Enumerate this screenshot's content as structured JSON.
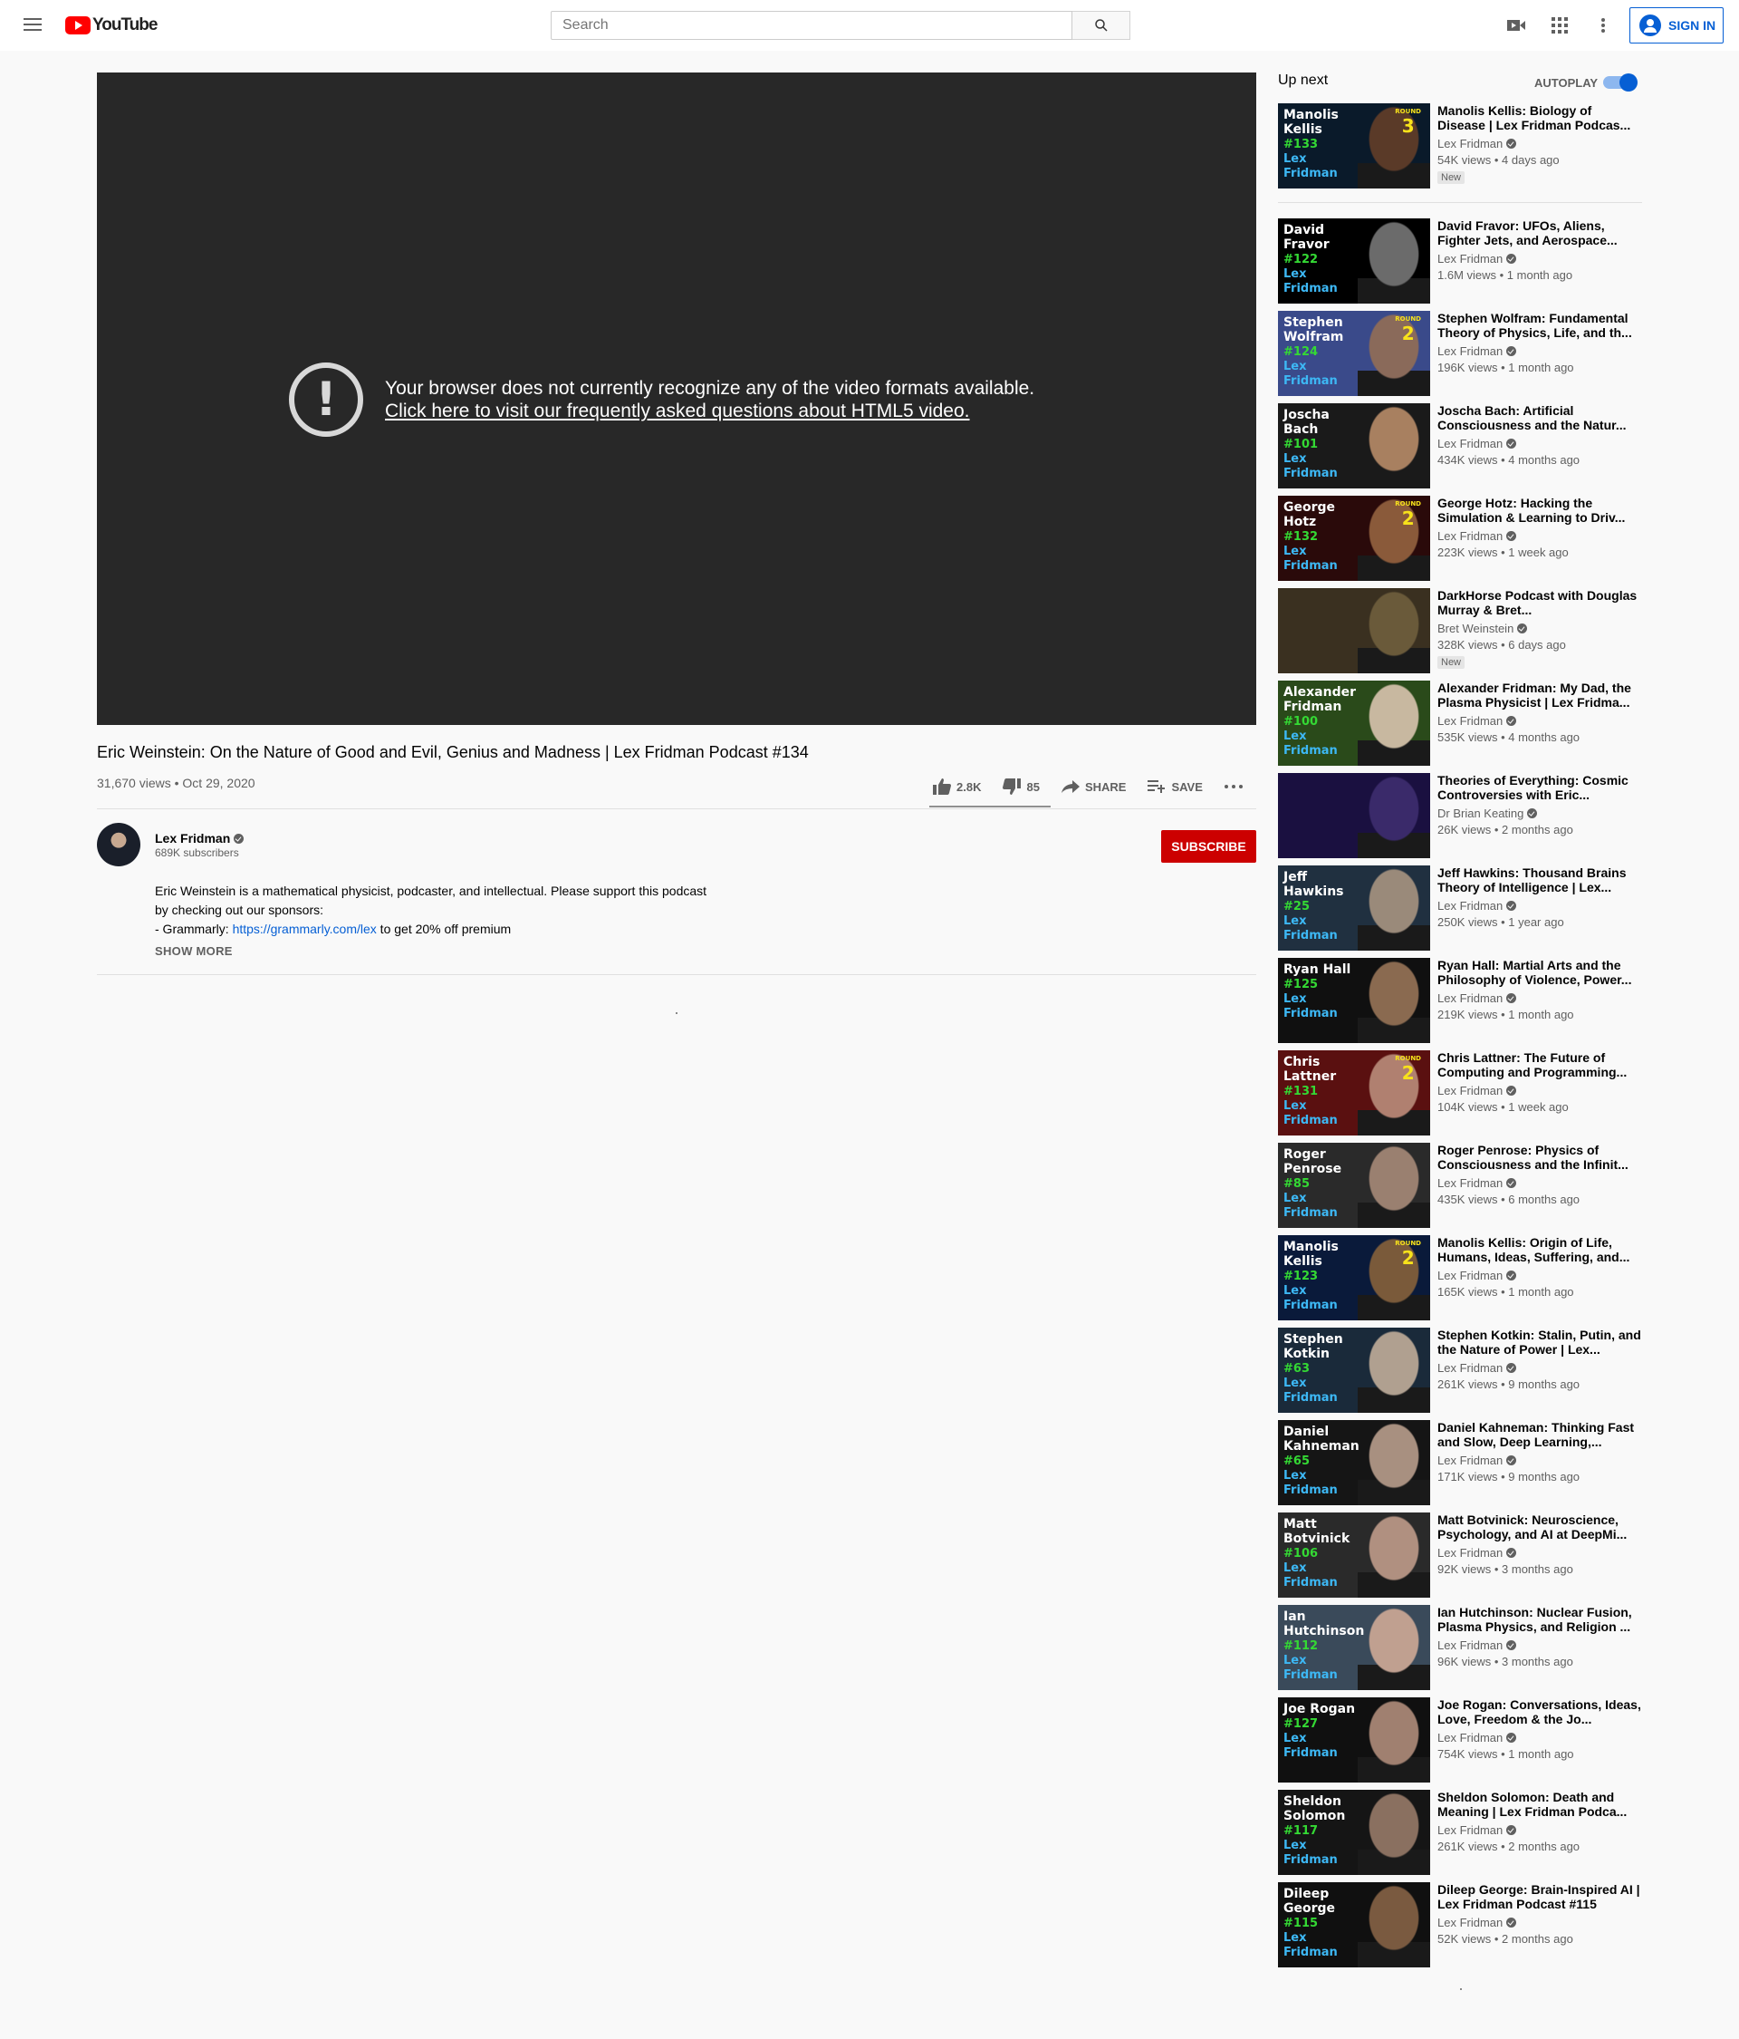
{
  "header": {
    "logo_text": "YouTube",
    "search_placeholder": "Search",
    "sign_in_label": "SIGN IN",
    "icons": [
      "menu-icon",
      "youtube-logo-icon",
      "search-icon",
      "create-video-icon",
      "apps-grid-icon",
      "more-vert-icon",
      "account-icon"
    ]
  },
  "player": {
    "error_line1": "Your browser does not currently recognize any of the video formats available.",
    "error_link": "Click here to visit our frequently asked questions about HTML5 video."
  },
  "video": {
    "title": "Eric Weinstein: On the Nature of Good and Evil, Genius and Madness | Lex Fridman Podcast #134",
    "meta": "31,670 views • Oct 29, 2020",
    "likes": "2.8K",
    "dislikes": "85",
    "share_label": "SHARE",
    "save_label": "SAVE"
  },
  "channel": {
    "name": "Lex Fridman",
    "subscribers": "689K subscribers",
    "subscribe_label": "SUBSCRIBE"
  },
  "description": {
    "line1": "Eric Weinstein is a mathematical physicist, podcaster, and intellectual. Please support this podcast",
    "line2": "by checking out our sponsors:",
    "line3_prefix": "- Grammarly: ",
    "line3_link": "https://grammarly.com/lex",
    "line3_suffix": " to get 20% off premium",
    "show_more": "SHOW MORE"
  },
  "sidebar": {
    "up_next": "Up next",
    "autoplay": "AUTOPLAY",
    "autoplay_on": true,
    "items": [
      {
        "thumb_name": "Manolis Kellis",
        "thumb_num": "#133",
        "round": "3",
        "title": "Manolis Kellis: Biology of Disease | Lex Fridman Podcas...",
        "channel": "Lex Fridman",
        "views": "54K views • 4 days ago",
        "badge": "New",
        "face": "#5a3a28",
        "bg": "#0a1a2a"
      },
      {
        "thumb_name": "David Fravor",
        "thumb_num": "#122",
        "round": "",
        "title": "David Fravor: UFOs, Aliens, Fighter Jets, and Aerospace...",
        "channel": "Lex Fridman",
        "views": "1.6M views • 1 month ago",
        "badge": "",
        "face": "#6b6b6b",
        "bg": "#000000"
      },
      {
        "thumb_name": "Stephen Wolfram",
        "thumb_num": "#124",
        "round": "2",
        "title": "Stephen Wolfram: Fundamental Theory of Physics, Life, and th...",
        "channel": "Lex Fridman",
        "views": "196K views • 1 month ago",
        "badge": "",
        "face": "#8a6a5a",
        "bg": "#3a4a8a"
      },
      {
        "thumb_name": "Joscha Bach",
        "thumb_num": "#101",
        "round": "",
        "title": "Joscha Bach: Artificial Consciousness and the Natur...",
        "channel": "Lex Fridman",
        "views": "434K views • 4 months ago",
        "badge": "",
        "face": "#a88060",
        "bg": "#1a1a1a"
      },
      {
        "thumb_name": "George Hotz",
        "thumb_num": "#132",
        "round": "2",
        "title": "George Hotz: Hacking the Simulation & Learning to Driv...",
        "channel": "Lex Fridman",
        "views": "223K views • 1 week ago",
        "badge": "",
        "face": "#8a5a3a",
        "bg": "#2a0a0a"
      },
      {
        "thumb_name": "",
        "thumb_num": "",
        "round": "",
        "title": "DarkHorse Podcast with Douglas Murray & Bret...",
        "channel": "Bret Weinstein",
        "views": "328K views • 6 days ago",
        "badge": "New",
        "face": "#6a5a3a",
        "bg": "#3a3020"
      },
      {
        "thumb_name": "Alexander Fridman",
        "thumb_num": "#100",
        "round": "",
        "title": "Alexander Fridman: My Dad, the Plasma Physicist | Lex Fridma...",
        "channel": "Lex Fridman",
        "views": "535K views • 4 months ago",
        "badge": "",
        "face": "#c8b8a0",
        "bg": "#2a4a1a"
      },
      {
        "thumb_name": "",
        "thumb_num": "",
        "round": "",
        "title": "Theories of Everything: Cosmic Controversies with Eric...",
        "channel": "Dr Brian Keating",
        "views": "26K views • 2 months ago",
        "badge": "",
        "face": "#3a2a6a",
        "bg": "#1a1040"
      },
      {
        "thumb_name": "Jeff Hawkins",
        "thumb_num": "#25",
        "round": "",
        "title": "Jeff Hawkins: Thousand Brains Theory of Intelligence | Lex...",
        "channel": "Lex Fridman",
        "views": "250K views • 1 year ago",
        "badge": "",
        "face": "#9a8a7a",
        "bg": "#203040"
      },
      {
        "thumb_name": "Ryan Hall",
        "thumb_num": "#125",
        "round": "",
        "title": "Ryan Hall: Martial Arts and the Philosophy of Violence, Power...",
        "channel": "Lex Fridman",
        "views": "219K views • 1 month ago",
        "badge": "",
        "face": "#8a6a50",
        "bg": "#101010"
      },
      {
        "thumb_name": "Chris Lattner",
        "thumb_num": "#131",
        "round": "2",
        "title": "Chris Lattner: The Future of Computing and Programming...",
        "channel": "Lex Fridman",
        "views": "104K views • 1 week ago",
        "badge": "",
        "face": "#b08070",
        "bg": "#5a1010"
      },
      {
        "thumb_name": "Roger Penrose",
        "thumb_num": "#85",
        "round": "",
        "title": "Roger Penrose: Physics of Consciousness and the Infinit...",
        "channel": "Lex Fridman",
        "views": "435K views • 6 months ago",
        "badge": "",
        "face": "#9a8070",
        "bg": "#2a2a2a"
      },
      {
        "thumb_name": "Manolis Kellis",
        "thumb_num": "#123",
        "round": "2",
        "title": "Manolis Kellis: Origin of Life, Humans, Ideas, Suffering, and...",
        "channel": "Lex Fridman",
        "views": "165K views • 1 month ago",
        "badge": "",
        "face": "#7a5a3a",
        "bg": "#0a1a3a"
      },
      {
        "thumb_name": "Stephen Kotkin",
        "thumb_num": "#63",
        "round": "",
        "title": "Stephen Kotkin: Stalin, Putin, and the Nature of Power | Lex...",
        "channel": "Lex Fridman",
        "views": "261K views • 9 months ago",
        "badge": "",
        "face": "#b0a090",
        "bg": "#1a2a3a"
      },
      {
        "thumb_name": "Daniel Kahneman",
        "thumb_num": "#65",
        "round": "",
        "title": "Daniel Kahneman: Thinking Fast and Slow, Deep Learning,...",
        "channel": "Lex Fridman",
        "views": "171K views • 9 months ago",
        "badge": "",
        "face": "#a89080",
        "bg": "#151515"
      },
      {
        "thumb_name": "Matt Botvinick",
        "thumb_num": "#106",
        "round": "",
        "title": "Matt Botvinick: Neuroscience, Psychology, and AI at DeepMi...",
        "channel": "Lex Fridman",
        "views": "92K views • 3 months ago",
        "badge": "",
        "face": "#b09080",
        "bg": "#2a2a2a"
      },
      {
        "thumb_name": "Ian Hutchinson",
        "thumb_num": "#112",
        "round": "",
        "title": "Ian Hutchinson: Nuclear Fusion, Plasma Physics, and Religion ...",
        "channel": "Lex Fridman",
        "views": "96K views • 3 months ago",
        "badge": "",
        "face": "#c0a090",
        "bg": "#3a4a5a"
      },
      {
        "thumb_name": "Joe Rogan",
        "thumb_num": "#127",
        "round": "",
        "title": "Joe Rogan: Conversations, Ideas, Love, Freedom & the Jo...",
        "channel": "Lex Fridman",
        "views": "754K views • 1 month ago",
        "badge": "",
        "face": "#a08070",
        "bg": "#101010"
      },
      {
        "thumb_name": "Sheldon Solomon",
        "thumb_num": "#117",
        "round": "",
        "title": "Sheldon Solomon: Death and Meaning | Lex Fridman Podca...",
        "channel": "Lex Fridman",
        "views": "261K views • 2 months ago",
        "badge": "",
        "face": "#8a7060",
        "bg": "#151515"
      },
      {
        "thumb_name": "Dileep George",
        "thumb_num": "#115",
        "round": "",
        "title": "Dileep George: Brain-Inspired AI | Lex Fridman Podcast #115",
        "channel": "Lex Fridman",
        "views": "52K views • 2 months ago",
        "badge": "",
        "face": "#7a5a40",
        "bg": "#101010"
      }
    ],
    "thumb_brand": "Lex Fridman",
    "round_label": "ROUND"
  }
}
